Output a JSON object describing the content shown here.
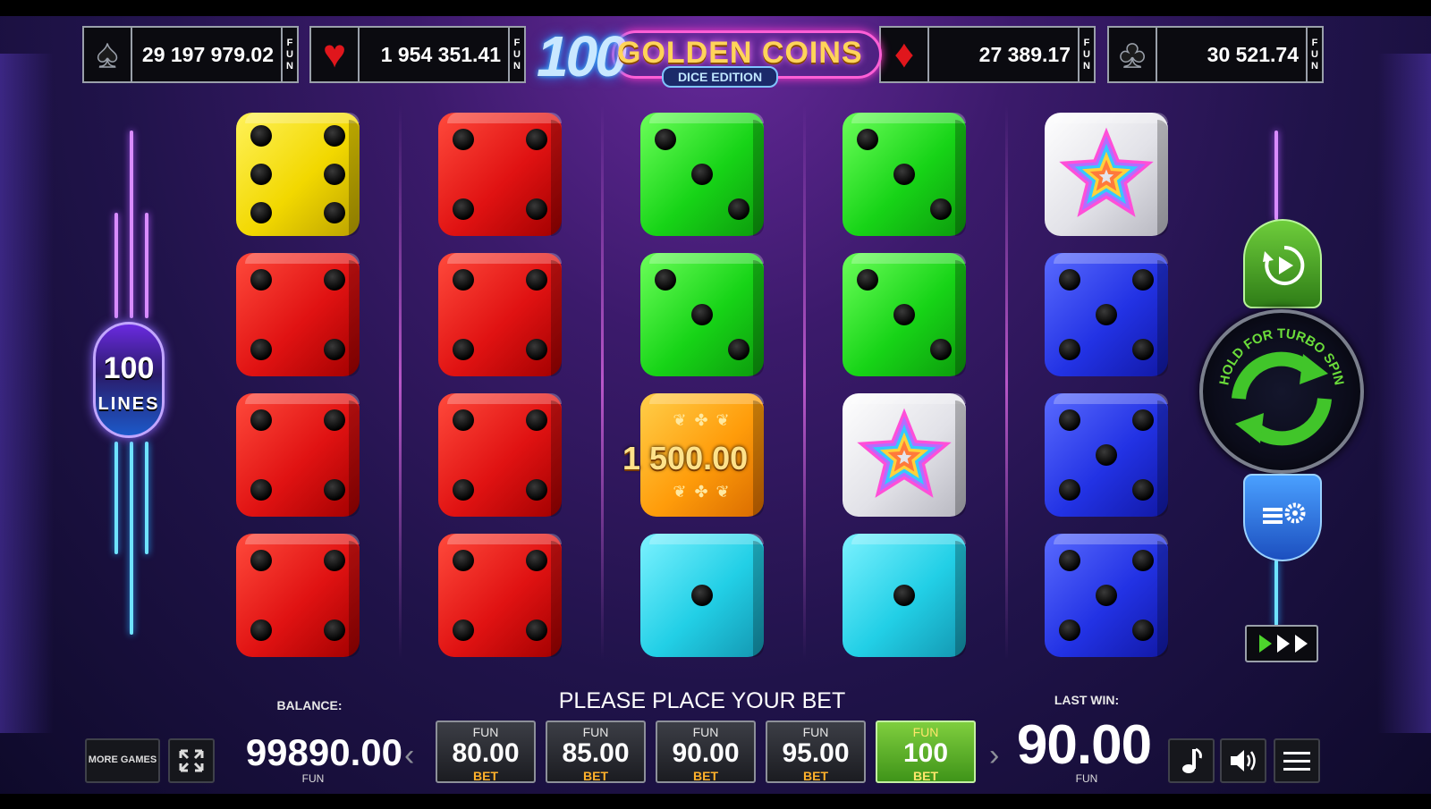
{
  "jackpots": [
    {
      "suit": "spade",
      "symbol": "♠",
      "value": "29 197 979.02",
      "unit": [
        "F",
        "U",
        "N"
      ]
    },
    {
      "suit": "heart",
      "symbol": "♥",
      "value": "1 954 351.41",
      "unit": [
        "F",
        "U",
        "N"
      ]
    },
    {
      "suit": "diamond",
      "symbol": "♦",
      "value": "27 389.17",
      "unit": [
        "F",
        "U",
        "N"
      ]
    },
    {
      "suit": "club",
      "symbol": "♣",
      "value": "30 521.74",
      "unit": [
        "F",
        "U",
        "N"
      ]
    }
  ],
  "logo": {
    "number": "100",
    "title": "GOLDEN COINS",
    "subtitle": "DICE EDITION"
  },
  "reels": [
    [
      {
        "color": "yellow",
        "face": 6
      },
      {
        "color": "red",
        "face": 4
      },
      {
        "color": "red",
        "face": 4
      },
      {
        "color": "red",
        "face": 4
      }
    ],
    [
      {
        "color": "red",
        "face": 4
      },
      {
        "color": "red",
        "face": 4
      },
      {
        "color": "red",
        "face": 4
      },
      {
        "color": "red",
        "face": 4
      }
    ],
    [
      {
        "color": "green",
        "face": 3
      },
      {
        "color": "green",
        "face": 3
      },
      {
        "color": "gold",
        "face": "coin"
      },
      {
        "color": "cyan",
        "face": 1
      }
    ],
    [
      {
        "color": "green",
        "face": 3
      },
      {
        "color": "green",
        "face": 3
      },
      {
        "color": "white",
        "face": "star"
      },
      {
        "color": "cyan",
        "face": 1
      }
    ],
    [
      {
        "color": "white",
        "face": "star"
      },
      {
        "color": "blue",
        "face": 5
      },
      {
        "color": "blue",
        "face": 5
      },
      {
        "color": "blue",
        "face": 5
      }
    ]
  ],
  "coin_win": "1 500.00",
  "lines": {
    "number": "100",
    "label": "LINES"
  },
  "controls": {
    "autoplay_icon": "autoplay-icon",
    "spin_hint": "HOLD FOR TURBO SPIN",
    "settings_icon": "settings-icon",
    "turbo_icon": "fast-forward-icon"
  },
  "bottom": {
    "message": "PLEASE PLACE YOUR BET",
    "balance_label": "BALANCE:",
    "balance_value": "99890.00",
    "balance_unit": "FUN",
    "more_games": "MORE GAMES",
    "last_win_label": "LAST WIN:",
    "last_win_value": "90.00",
    "last_win_unit": "FUN",
    "bets": [
      {
        "unit": "FUN",
        "value": "80.00",
        "label": "BET",
        "selected": false
      },
      {
        "unit": "FUN",
        "value": "85.00",
        "label": "BET",
        "selected": false
      },
      {
        "unit": "FUN",
        "value": "90.00",
        "label": "BET",
        "selected": false
      },
      {
        "unit": "FUN",
        "value": "95.00",
        "label": "BET",
        "selected": false
      },
      {
        "unit": "FUN",
        "value": "100",
        "label": "BET",
        "selected": true
      }
    ]
  },
  "colors": {
    "accent_green": "#5fbf2a",
    "neon_pink": "#ff5fd6",
    "neon_blue": "#6fe3ff",
    "bet_label": "#ffb12b"
  }
}
